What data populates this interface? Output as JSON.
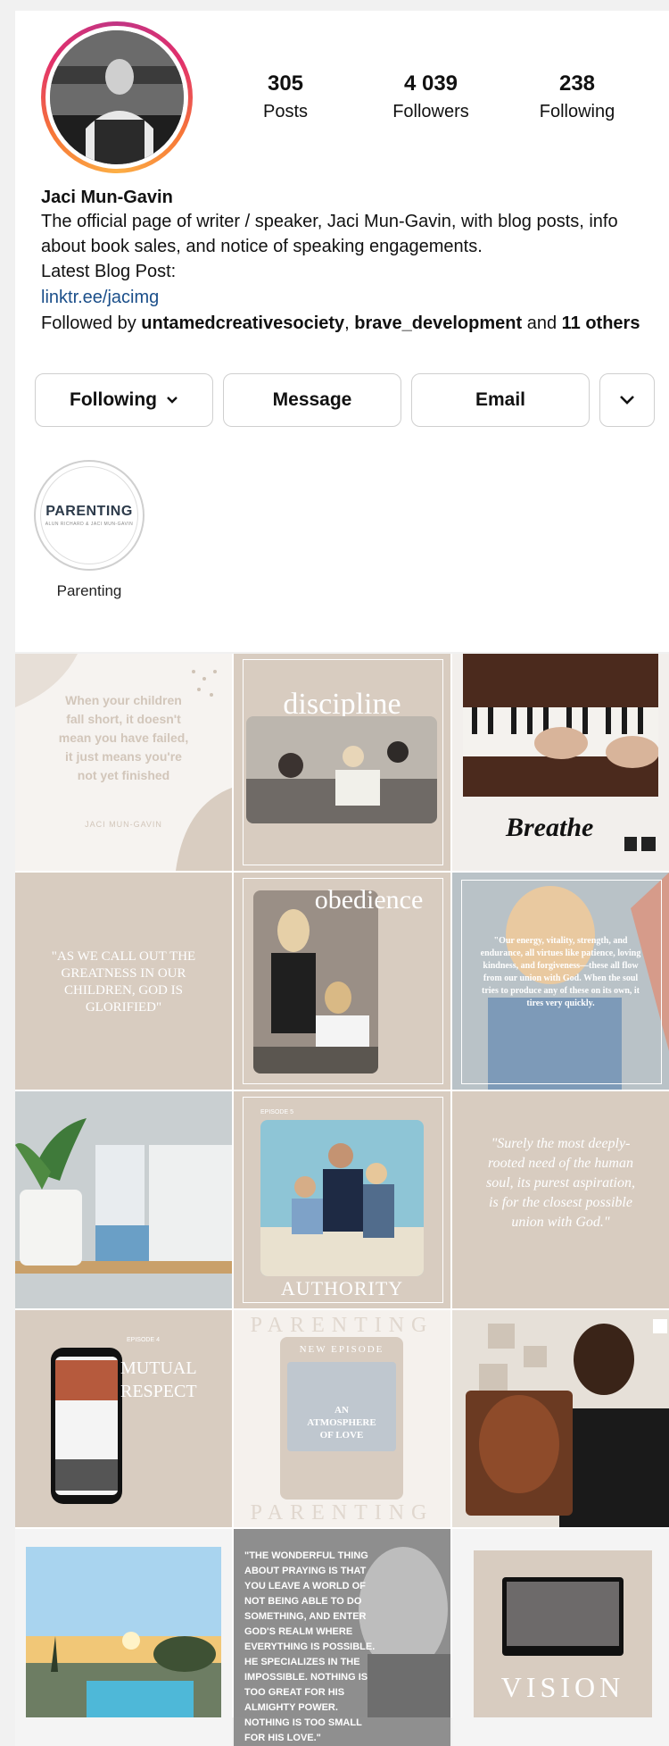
{
  "profile": {
    "name": "Jaci Mun-Gavin",
    "bio_line1": "The official page of writer / speaker, Jaci Mun-Gavin, with blog posts, info",
    "bio_line2": "about book sales, and notice of speaking engagements.",
    "bio_line3": "Latest Blog Post:",
    "link": "linktr.ee/jacimg",
    "followed_by_prefix": "Followed by ",
    "followed_by_user1": "untamedcreativesociety",
    "followed_by_sep": ", ",
    "followed_by_user2": "brave_development",
    "followed_by_and": " and ",
    "followed_by_others": "11 others"
  },
  "stats": {
    "posts_count": "305",
    "posts_label": "Posts",
    "followers_count": "4 039",
    "followers_label": "Followers",
    "following_count": "238",
    "following_label": "Following"
  },
  "buttons": {
    "following": "Following",
    "message": "Message",
    "email": "Email"
  },
  "highlights": [
    {
      "label": "Parenting",
      "cover_title": "PARENTING",
      "cover_sub": "ALUN RICHARD & JACI MUN-GAVIN"
    }
  ],
  "posts": {
    "p1_text": "When your children fall short, it doesn't mean you have failed, it just means you're not yet finished",
    "p1_author": "JACI MUN-GAVIN",
    "p2_title": "discipline",
    "p3_text": "Breathe",
    "p4_text": "\"AS WE CALL OUT THE GREATNESS IN OUR CHILDREN, GOD IS GLORIFIED\"",
    "p5_title": "obedience",
    "p6_text": "\"Our energy, vitality, strength, and endurance, all virtues like patience, loving kindness, and forgiveness—these all flow from our union with God. When the soul tries to produce any of these on its own, it tires very quickly.",
    "p8_episode": "EPISODE 5",
    "p8_title": "AUTHORITY",
    "p9_text": "\"Surely the most deeply-rooted need of the human soul, its purest aspiration, is for the closest possible union with God.\"",
    "p10_episode": "EPISODE 4",
    "p10_title": "MUTUAL RESPECT",
    "p11_word": "PARENTING",
    "p11_episode": "NEW EPISODE",
    "p11_title": "AN ATMOSPHERE OF LOVE",
    "p14_text": "\"THE WONDERFUL THING ABOUT PRAYING IS THAT YOU LEAVE A WORLD OF NOT BEING ABLE TO DO SOMETHING, AND ENTER GOD'S REALM WHERE EVERYTHING IS POSSIBLE. HE SPECIALIZES IN THE IMPOSSIBLE. NOTHING IS TOO GREAT FOR HIS ALMIGHTY POWER. NOTHING IS TOO SMALL FOR HIS LOVE.\"",
    "p15_title": "VISION"
  },
  "colors": {
    "link": "#1b4f8a",
    "tile_beige": "#d8ccc0",
    "ring_start": "#c13584",
    "ring_end": "#fcaf45"
  }
}
